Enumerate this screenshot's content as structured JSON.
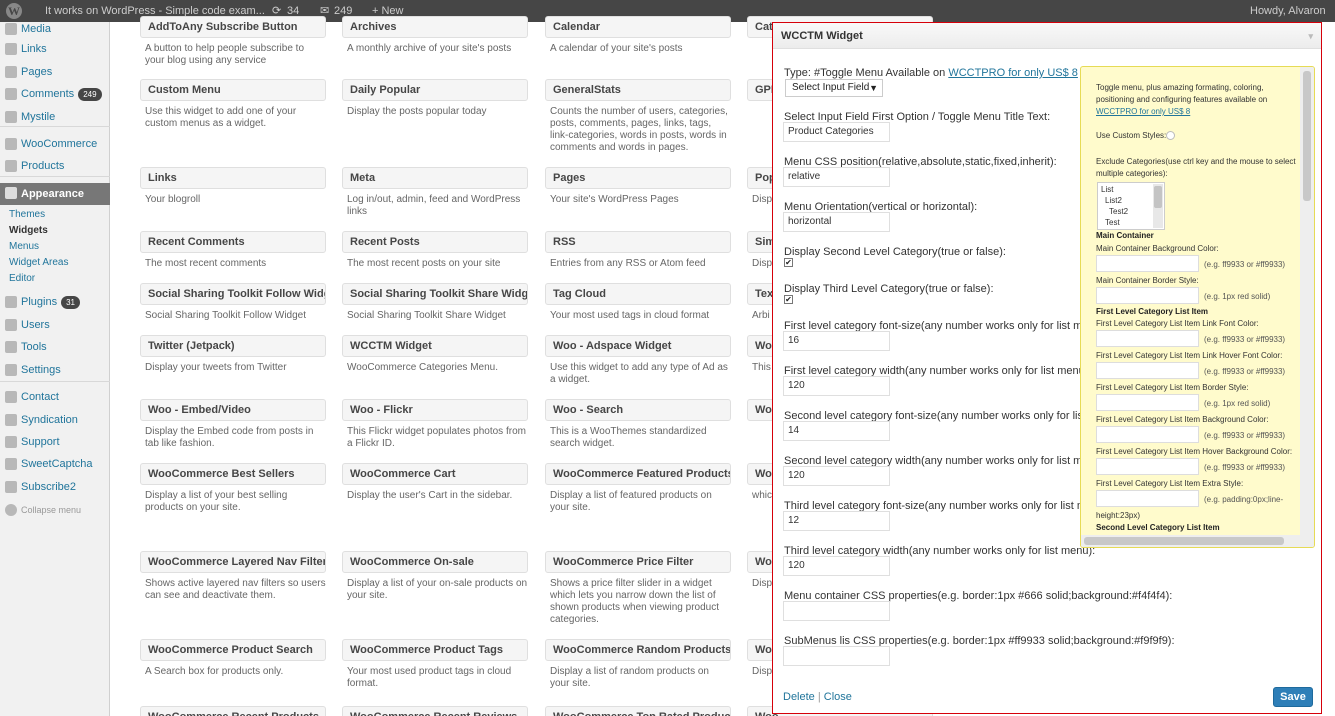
{
  "adminbar": {
    "site_title": "It works on WordPress - Simple code exam...",
    "updates": "34",
    "comments": "249",
    "new_label": "+ New",
    "howdy": "Howdy, Alvaron"
  },
  "sidebar": {
    "media": "Media",
    "links": "Links",
    "pages": "Pages",
    "comments": "Comments",
    "comments_badge": "249",
    "mystile": "Mystile",
    "woocommerce": "WooCommerce",
    "products": "Products",
    "appearance": "Appearance",
    "sub": [
      "Themes",
      "Widgets",
      "Menus",
      "Widget Areas",
      "Editor"
    ],
    "plugins": "Plugins",
    "plugins_badge": "31",
    "users": "Users",
    "tools": "Tools",
    "settings": "Settings",
    "contact": "Contact",
    "syndication": "Syndication",
    "support": "Support",
    "sweetcaptcha": "SweetCaptcha",
    "subscribe2": "Subscribe2",
    "collapse": "Collapse menu"
  },
  "widgets": [
    {
      "title": "AddToAny Subscribe Button",
      "desc": "A button to help people subscribe to your blog using any service"
    },
    {
      "title": "Archives",
      "desc": "A monthly archive of your site's posts"
    },
    {
      "title": "Calendar",
      "desc": "A calendar of your site's posts"
    },
    {
      "title": "Custom Menu",
      "desc": "Use this widget to add one of your custom menus as a widget."
    },
    {
      "title": "Daily Popular",
      "desc": "Display the posts popular today"
    },
    {
      "title": "GeneralStats",
      "desc": "Counts the number of users, categories, posts, comments, pages, links, tags, link-categories, words in posts, words in comments and words in pages."
    },
    {
      "title": "Links",
      "desc": "Your blogroll"
    },
    {
      "title": "Meta",
      "desc": "Log in/out, admin, feed and WordPress links"
    },
    {
      "title": "Pages",
      "desc": "Your site's WordPress Pages"
    },
    {
      "title": "Recent Comments",
      "desc": "The most recent comments"
    },
    {
      "title": "Recent Posts",
      "desc": "The most recent posts on your site"
    },
    {
      "title": "RSS",
      "desc": "Entries from any RSS or Atom feed"
    },
    {
      "title": "Social Sharing Toolkit Follow Widget",
      "desc": "Social Sharing Toolkit Follow Widget"
    },
    {
      "title": "Social Sharing Toolkit Share Widget",
      "desc": "Social Sharing Toolkit Share Widget"
    },
    {
      "title": "Tag Cloud",
      "desc": "Your most used tags in cloud format"
    },
    {
      "title": "Twitter (Jetpack)",
      "desc": "Display your tweets from Twitter"
    },
    {
      "title": "WCCTM Widget",
      "desc": "WooCommerce Categories Menu."
    },
    {
      "title": "Woo - Adspace Widget",
      "desc": "Use this widget to add any type of Ad as a widget."
    },
    {
      "title": "Woo - Embed/Video",
      "desc": "Display the Embed code from posts in tab like fashion."
    },
    {
      "title": "Woo - Flickr",
      "desc": "This Flickr widget populates photos from a Flickr ID."
    },
    {
      "title": "Woo - Search",
      "desc": "This is a WooThemes standardized search widget."
    },
    {
      "title": "WooCommerce Best Sellers",
      "desc": "Display a list of your best selling products on your site."
    },
    {
      "title": "WooCommerce Cart",
      "desc": "Display the user's Cart in the sidebar."
    },
    {
      "title": "WooCommerce Featured Products",
      "desc": "Display a list of featured products on your site."
    },
    {
      "title": "WooCommerce Layered Nav Filters",
      "desc": "Shows active layered nav filters so users can see and deactivate them."
    },
    {
      "title": "WooCommerce On-sale",
      "desc": "Display a list of your on-sale products on your site."
    },
    {
      "title": "WooCommerce Price Filter",
      "desc": "Shows a price filter slider in a widget which lets you narrow down the list of shown products when viewing product categories."
    },
    {
      "title": "WooCommerce Product Search",
      "desc": "A Search box for products only."
    },
    {
      "title": "WooCommerce Product Tags",
      "desc": "Your most used product tags in cloud format."
    },
    {
      "title": "WooCommerce Random Products",
      "desc": "Display a list of random products on your site."
    },
    {
      "title": "WooCommerce Recent Products",
      "desc": ""
    },
    {
      "title": "WooCommerce Recent Reviews",
      "desc": ""
    },
    {
      "title": "WooCommerce Top Rated Products",
      "desc": ""
    }
  ],
  "col4": [
    {
      "title": "Cate",
      "desc": ""
    },
    {
      "title": "GPL",
      "desc": ""
    },
    {
      "title": "Pop",
      "desc": "Disp"
    },
    {
      "title": "Sim",
      "desc": "Disp"
    },
    {
      "title": "Text",
      "desc": "Arbi"
    },
    {
      "title": "Woo",
      "desc": "This"
    },
    {
      "title": "Woo",
      "desc": ""
    },
    {
      "title": "Woo",
      "desc": "whic"
    },
    {
      "title": "Woo",
      "desc": "Disp"
    },
    {
      "title": "Woo",
      "desc": "Disp"
    },
    {
      "title": "Woo",
      "desc": "Disp"
    }
  ],
  "panel": {
    "title": "WCCTM Widget",
    "type_label": "Type: #Toggle Menu Available on ",
    "type_link": "WCCTPRO for only US$ 8",
    "select_value": "Select Input Field",
    "fields": [
      {
        "label": "Select Input Field First Option / Toggle Menu Title Text:",
        "value": "Product Categories"
      },
      {
        "label": "Menu CSS position(relative,absolute,static,fixed,inherit):",
        "value": "relative"
      },
      {
        "label": "Menu Orientation(vertical or horizontal):",
        "value": "horizontal"
      },
      {
        "label": "Display Second Level Category(true or false):",
        "checked": "✔"
      },
      {
        "label": "Display Third Level Category(true or false):",
        "checked": "✔"
      },
      {
        "label": "First level category font-size(any number works only for list menu):",
        "value": "16"
      },
      {
        "label": "First level category width(any number works only for list menu):",
        "value": "120"
      },
      {
        "label": "Second level category font-size(any number works only for list menu):",
        "value": "14"
      },
      {
        "label": "Second level category width(any number works only for list menu):",
        "value": "120"
      },
      {
        "label": "Third level category font-size(any number works only for list menu):",
        "value": "12"
      },
      {
        "label": "Third level category width(any number works only for list menu):",
        "value": "120"
      },
      {
        "label": "Menu container CSS properties(e.g. border:1px #666 solid;background:#f4f4f4):",
        "value": ""
      },
      {
        "label": "SubMenus lis CSS properties(e.g. border:1px #ff9933 solid;background:#f9f9f9):",
        "value": ""
      }
    ],
    "delete": "Delete",
    "sep": "|",
    "close": "Close",
    "save": "Save"
  },
  "promo": {
    "intro1": "Toggle menu, plus amazing formating, coloring,",
    "intro2": "positioning and configuring features available on",
    "intro_link": "WCCTPRO for only US$ 8",
    "custom_styles": "Use Custom Styles:",
    "exclude1": "Exclude Categories(use ctrl key and the mouse to select",
    "exclude2": "multiple categories):",
    "list": [
      "List",
      "List2",
      "Test2",
      "Test"
    ],
    "main_container": "Main Container",
    "bg_color": "Main Container Background Color:",
    "hint_color": "(e.g. ff9933 or #ff9933)",
    "border_style": "Main Container Border Style:",
    "hint_border": "(e.g. 1px red solid)",
    "first_level": "First Level Category List Item",
    "link_font": "First Level Category List Item Link Font Color:",
    "hover_font": "First Level Category List Item Link Hover Font Color:",
    "item_border": "First Level Category List Item Border Style:",
    "item_bg": "First Level Category List Item Background Color:",
    "item_hover_bg": "First Level Category List Item Hover Background Color:",
    "extra": "First Level Category List Item Extra Style:",
    "hint_extra1": "(e.g. padding:0px;line-",
    "hint_extra2": "height:23px)",
    "second_level": "Second Level Category List Item"
  },
  "colors": {
    "adminbar": "#464646",
    "link": "#21759b",
    "panel_border": "#d6000a",
    "save": "#2e7fb8",
    "promo_bg": "#fffbcc"
  }
}
